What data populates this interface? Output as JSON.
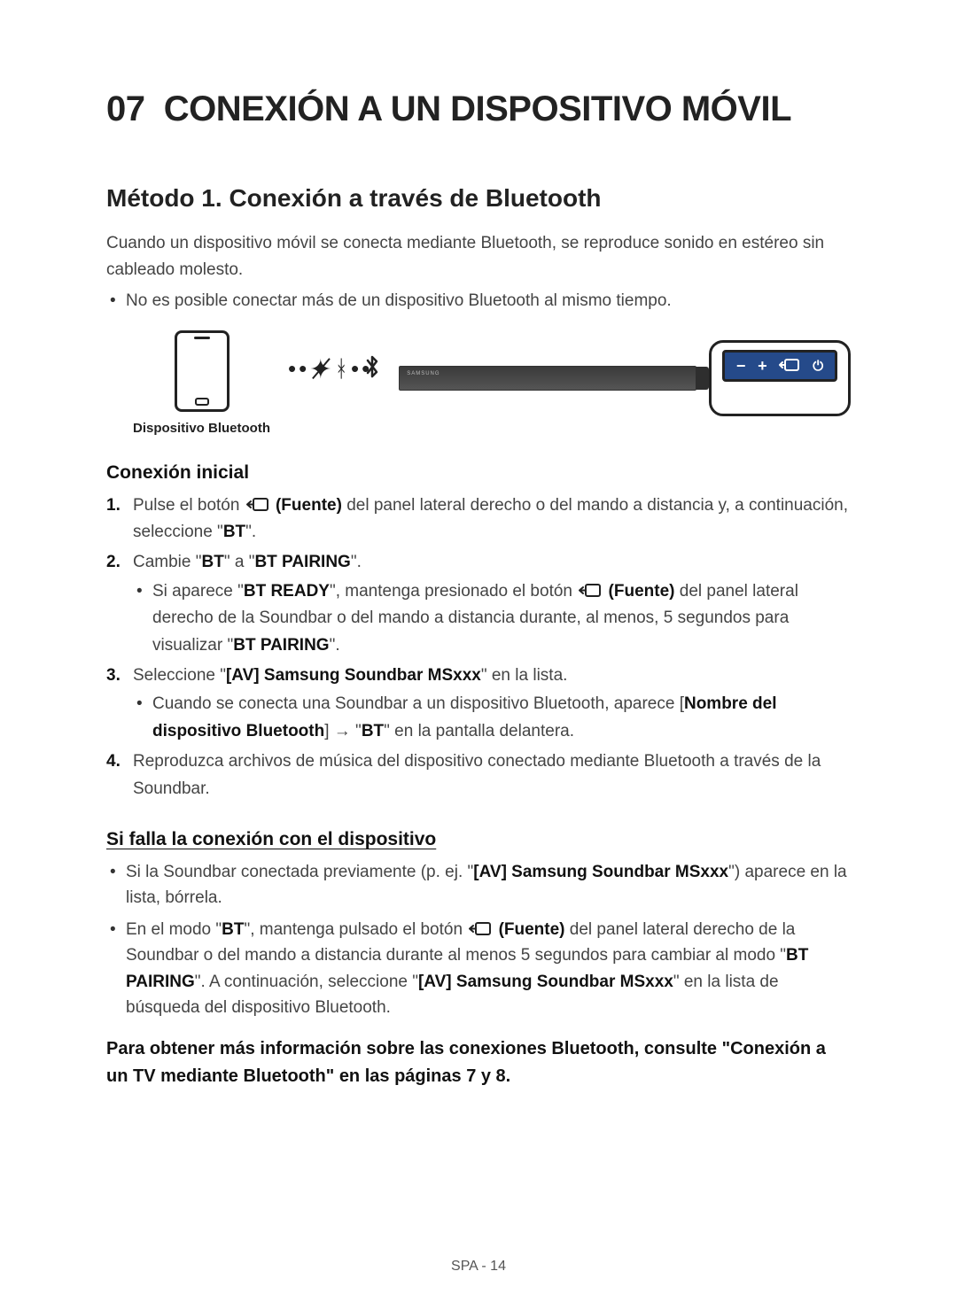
{
  "chapter": {
    "number": "07",
    "title": "CONEXIÓN A UN DISPOSITIVO MÓVIL"
  },
  "section": {
    "title": "Método 1. Conexión a través de Bluetooth"
  },
  "lead": "Cuando un dispositivo móvil se conecta mediante Bluetooth, se reproduce sonido en estéreo sin cableado molesto.",
  "lead_bullet": "No es posible conectar más de un dispositivo Bluetooth al mismo tiempo.",
  "diagram": {
    "phone_label": "Dispositivo Bluetooth",
    "soundbar_brand": "SAMSUNG",
    "panel_buttons": {
      "minus": "−",
      "plus": "+",
      "power": "⏻"
    }
  },
  "initial": {
    "heading": "Conexión inicial",
    "step1_a": "Pulse el botón ",
    "step1_source": "(Fuente)",
    "step1_b": " del panel lateral derecho o del mando a distancia y, a continuación, seleccione \"",
    "step1_bt": "BT",
    "step1_c": "\".",
    "step2_a": "Cambie \"",
    "step2_bt": "BT",
    "step2_b": "\" a \"",
    "step2_pair": "BT PAIRING",
    "step2_c": "\".",
    "step2_sub_a": "Si aparece \"",
    "step2_sub_ready": "BT READY",
    "step2_sub_b": "\", mantenga presionado el botón ",
    "step2_sub_source": "(Fuente)",
    "step2_sub_c": " del panel lateral derecho de la Soundbar o del mando a distancia durante, al menos, 5 segundos para visualizar \"",
    "step2_sub_pair": "BT PAIRING",
    "step2_sub_d": "\".",
    "step3_a": "Seleccione \"",
    "step3_name": "[AV] Samsung Soundbar MSxxx",
    "step3_b": "\" en la lista.",
    "step3_sub_a": "Cuando se conecta una Soundbar a un dispositivo Bluetooth, aparece [",
    "step3_sub_name": "Nombre del dispositivo Bluetooth",
    "step3_sub_b": "] → \"",
    "step3_sub_bt": "BT",
    "step3_sub_c": "\" en la pantalla delantera.",
    "step4": "Reproduzca archivos de música del dispositivo conectado mediante Bluetooth a través de la Soundbar."
  },
  "fail": {
    "heading": "Si falla la conexión con el dispositivo",
    "b1_a": "Si la Soundbar conectada previamente (p. ej. \"",
    "b1_name": "[AV] Samsung Soundbar MSxxx",
    "b1_b": "\") aparece en la lista, bórrela.",
    "b2_a": "En el modo \"",
    "b2_bt": "BT",
    "b2_b": "\", mantenga pulsado el botón ",
    "b2_source": "(Fuente)",
    "b2_c": " del panel lateral derecho de la Soundbar o del mando a distancia durante al menos 5 segundos para cambiar al modo \"",
    "b2_pair": "BT PAIRING",
    "b2_d": "\". A continuación, seleccione \"",
    "b2_name": "[AV] Samsung Soundbar MSxxx",
    "b2_e": "\" en la lista de búsqueda del dispositivo Bluetooth."
  },
  "more_info": "Para obtener más información sobre las conexiones Bluetooth, consulte \"Conexión a un TV mediante Bluetooth\" en las páginas 7 y 8.",
  "footer": "SPA - 14"
}
